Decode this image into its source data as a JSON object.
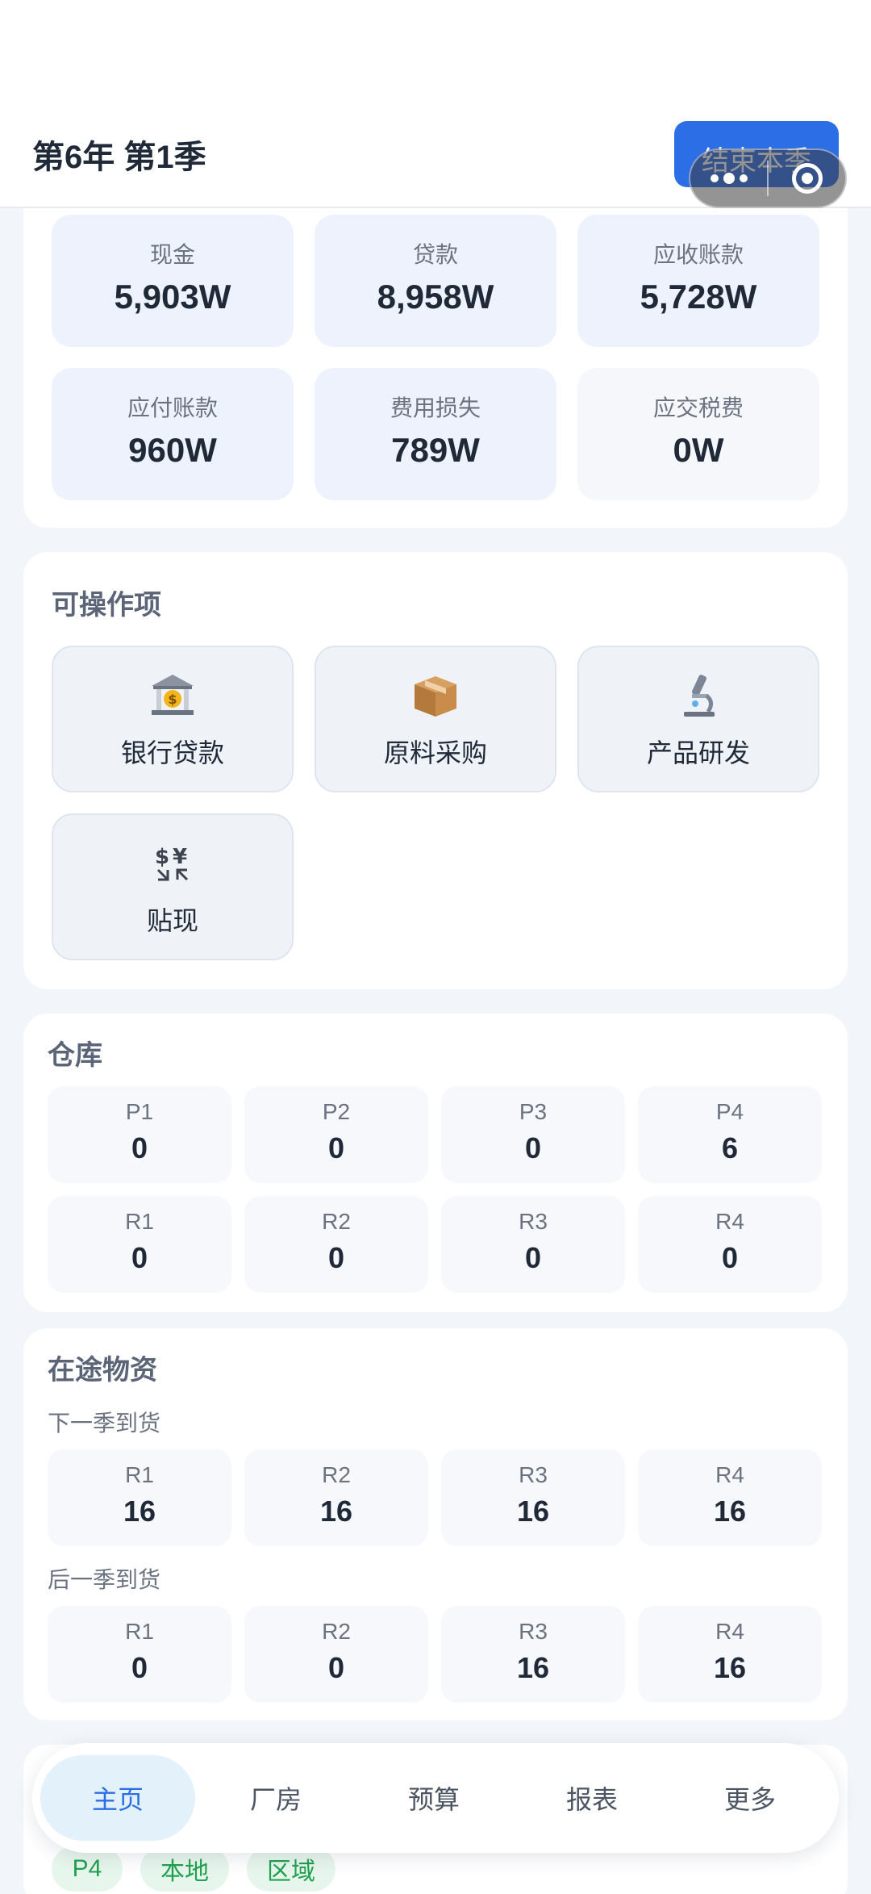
{
  "header": {
    "title": "第6年 第1季",
    "end_button": "结束本季"
  },
  "finance": {
    "tiles": [
      {
        "label": "现金",
        "value": "5,903W"
      },
      {
        "label": "贷款",
        "value": "8,958W"
      },
      {
        "label": "应收账款",
        "value": "5,728W"
      },
      {
        "label": "应付账款",
        "value": "960W"
      },
      {
        "label": "费用损失",
        "value": "789W"
      },
      {
        "label": "应交税费",
        "value": "0W"
      }
    ]
  },
  "actions": {
    "title": "可操作项",
    "items": [
      {
        "label": "银行贷款",
        "icon": "bank-icon"
      },
      {
        "label": "原料采购",
        "icon": "package-icon"
      },
      {
        "label": "产品研发",
        "icon": "microscope-icon"
      },
      {
        "label": "贴现",
        "icon": "currency-exchange-icon"
      }
    ]
  },
  "warehouse": {
    "title": "仓库",
    "products": [
      {
        "label": "P1",
        "value": "0"
      },
      {
        "label": "P2",
        "value": "0"
      },
      {
        "label": "P3",
        "value": "0"
      },
      {
        "label": "P4",
        "value": "6"
      }
    ],
    "materials": [
      {
        "label": "R1",
        "value": "0"
      },
      {
        "label": "R2",
        "value": "0"
      },
      {
        "label": "R3",
        "value": "0"
      },
      {
        "label": "R4",
        "value": "0"
      }
    ]
  },
  "in_transit": {
    "title": "在途物资",
    "next": {
      "label": "下一季到货",
      "items": [
        {
          "label": "R1",
          "value": "16"
        },
        {
          "label": "R2",
          "value": "16"
        },
        {
          "label": "R3",
          "value": "16"
        },
        {
          "label": "R4",
          "value": "16"
        }
      ]
    },
    "after": {
      "label": "后一季到货",
      "items": [
        {
          "label": "R1",
          "value": "0"
        },
        {
          "label": "R2",
          "value": "0"
        },
        {
          "label": "R3",
          "value": "16"
        },
        {
          "label": "R4",
          "value": "16"
        }
      ]
    }
  },
  "tags": [
    "P4",
    "本地",
    "区域"
  ],
  "tabbar": {
    "tabs": [
      "主页",
      "厂房",
      "预算",
      "报表",
      "更多"
    ],
    "active_index": 0
  },
  "colors": {
    "accent": "#2b6ee6",
    "tile_blue": "#edf2fd",
    "tag_green": "#21a150"
  }
}
